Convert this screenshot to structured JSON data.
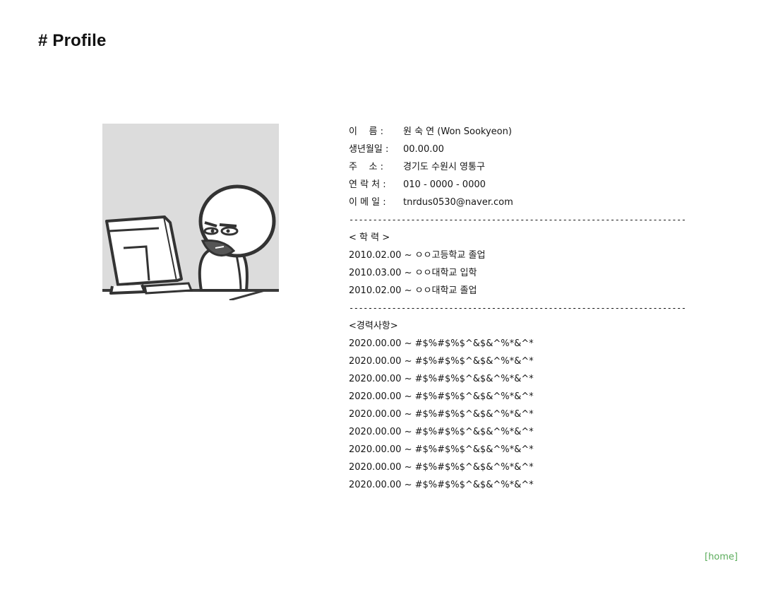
{
  "page": {
    "title": "# Profile",
    "home_link": "[home]",
    "home_link_color": "#5cad5c"
  },
  "avatar": {
    "icon": "person-at-computer-meme-icon",
    "background": "#dcdcdc"
  },
  "profile": {
    "name": {
      "label": "이    름 : ",
      "value": "원 숙 연 (Won Sookyeon)"
    },
    "birth": {
      "label": "생년월일 : ",
      "value": "00.00.00"
    },
    "address": {
      "label": "주    소 : ",
      "value": "경기도 수원시 영통구"
    },
    "contact": {
      "label": "연 락 처 : ",
      "value": "010 - 0000 - 0000"
    },
    "email": {
      "label": "이 메 일 : ",
      "value": "tnrdus0530@naver.com"
    }
  },
  "separator": "-----------------------------------------------------------------------",
  "education": {
    "heading": "< 학 력 >",
    "items": [
      "2010.02.00 ~ ㅇㅇ고등학교 졸업",
      "2010.03.00 ~ ㅇㅇ대학교 입학",
      "2010.02.00 ~ ㅇㅇ대학교 졸업"
    ]
  },
  "career": {
    "heading": "<경력사항>",
    "items": [
      "2020.00.00 ~ #$%#$%$^&$&^%*&^*",
      "2020.00.00 ~ #$%#$%$^&$&^%*&^*",
      "2020.00.00 ~ #$%#$%$^&$&^%*&^*",
      "2020.00.00 ~ #$%#$%$^&$&^%*&^*",
      "2020.00.00 ~ #$%#$%$^&$&^%*&^*",
      "2020.00.00 ~ #$%#$%$^&$&^%*&^*",
      "2020.00.00 ~ #$%#$%$^&$&^%*&^*",
      "2020.00.00 ~ #$%#$%$^&$&^%*&^*",
      "2020.00.00 ~ #$%#$%$^&$&^%*&^*"
    ]
  }
}
